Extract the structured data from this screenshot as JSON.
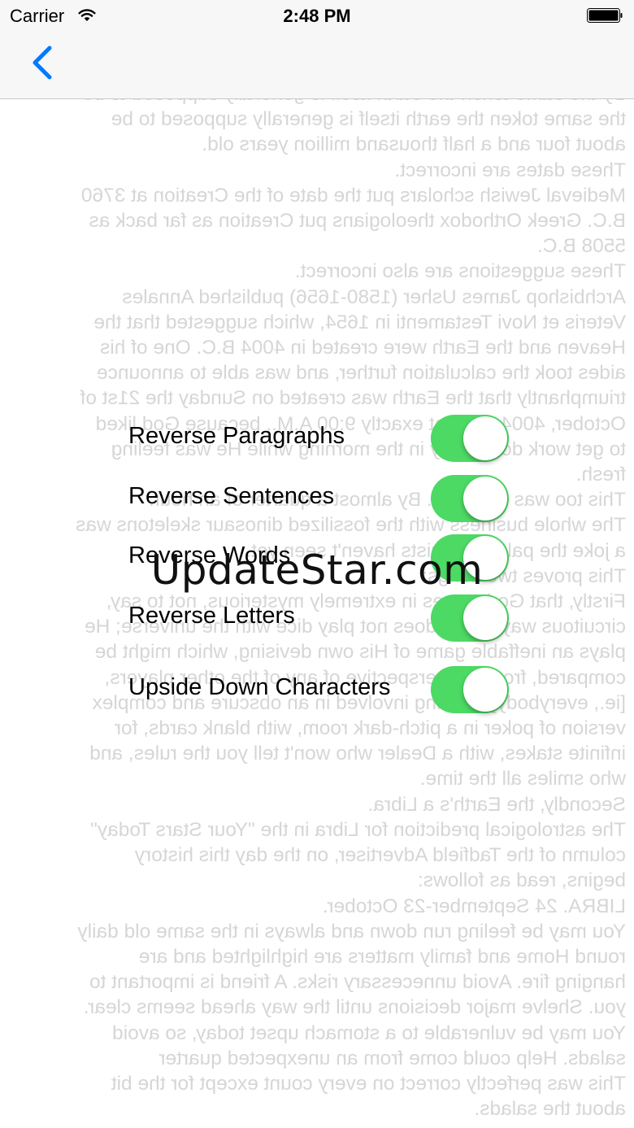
{
  "status_bar": {
    "carrier": "Carrier",
    "time": "2:48 PM",
    "wifi_icon": "wifi-icon",
    "battery_icon": "battery-icon"
  },
  "nav": {
    "back_icon": "chevron-left-icon",
    "accent_color": "#007aff"
  },
  "background_text": {
    "color": "#d6d6d6",
    "lines": [
      "By the same token the earth itself is generally supposed to be",
      "the same token the earth itself is generally supposed to be",
      "about four and a half thousand million years old.",
      "These dates are incorrect.",
      "Medieval Jewish scholars put the date of the Creation at 3760",
      "B.C. Greek Orthodox theologians put Creation as far back as",
      "5508 B.C.",
      "These suggestions are also incorrect.",
      "Archbishop James Usher (1580-1656) published Annales",
      "Veteris et Novi Testamenti in 1654, which suggested that the",
      "Heaven and the Earth were created in 4004 B.C. One of his",
      "aides took the calculation further, and was able to announce",
      "triumphantly that the Earth was created on Sunday the 21st of",
      "October, 4004 B.C., at exactly 9:00 A.M., because God liked",
      "to get work done early in the morning while He was feeling",
      "fresh.",
      "This too was incorrect. By almost a quarter of an hour.",
      "The whole business with the fossilized dinosaur skeletons was",
      "a joke the paleontologists haven't seen yet.",
      "This proves two things:",
      "Firstly, that God moves in extremely mysterious, not to say,",
      "circuitous ways. God does not play dice with the universe; He",
      "plays an ineffable game of His own devising, which might be",
      "compared, from the perspective of any of the other players,",
      "[ie., everybody] to being involved in an obscure and complex",
      "version of poker in a pitch-dark room, with blank cards, for",
      "infinite stakes, with a Dealer who won't tell you the rules, and",
      "who smiles all the time.",
      "Secondly, the Earth's a Libra.",
      "The astrological prediction for Libra in the \"Your Stars Today\"",
      "column of the Tadfield Advertiser, on the day this history",
      "begins, read as follows:",
      "LIBRA. 24 September-23 October.",
      "You may be feeling run down and always in the same old daily",
      "round Home and family matters are highlighted and are",
      "hanging fire. Avoid unnecessary risks. A friend is important to",
      "you. Shelve major decisions until the way ahead seems clear.",
      "You may be vulnerable to a stomach upset today, so avoid",
      "salads. Help could come from an unexpected quarter",
      "This was perfectly correct on every count except for the bit",
      "about the salads."
    ]
  },
  "settings": {
    "toggle_on_color": "#4cd964",
    "items": [
      {
        "label": "Reverse Paragraphs",
        "on": true
      },
      {
        "label": "Reverse Sentences",
        "on": true
      },
      {
        "label": "Reverse Words",
        "on": true
      },
      {
        "label": "Reverse Letters",
        "on": true
      },
      {
        "label": "Upside Down Characters",
        "on": true
      }
    ]
  },
  "watermark": "UpdateStar.com"
}
